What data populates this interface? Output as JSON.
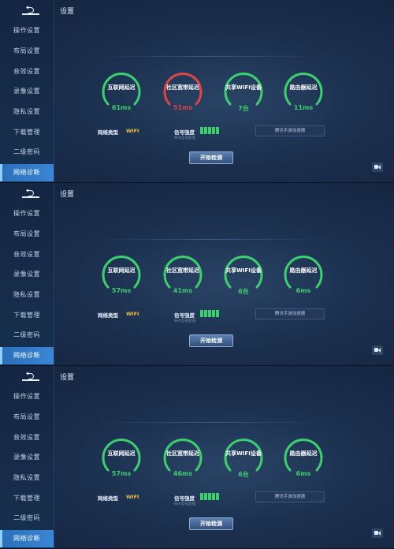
{
  "screens": [
    {
      "title": "设置",
      "nav": [
        "操作设置",
        "布局设置",
        "音效设置",
        "录像设置",
        "隐私设置",
        "下载管理",
        "二级密码",
        "网络诊断"
      ],
      "active_index": 7,
      "gauges": [
        {
          "label": "互联网延迟",
          "value": "61ms",
          "status": "good"
        },
        {
          "label": "社区宽带延迟",
          "value": "51ms",
          "status": "bad"
        },
        {
          "label": "共享WIFI设备",
          "value": "7台",
          "status": "good"
        },
        {
          "label": "路由器延迟",
          "value": "11ms",
          "status": "good"
        }
      ],
      "network_type_label": "网络类型",
      "network_type_value": "WIFI",
      "signal_label": "信号强度",
      "signal_sub": "WiFi信号较强",
      "signal_bars": 5,
      "accel_button": "腾讯手游加速器",
      "start_button": "开始检测"
    },
    {
      "title": "设置",
      "nav": [
        "操作设置",
        "布局设置",
        "音效设置",
        "录像设置",
        "隐私设置",
        "下载管理",
        "二级密码",
        "网络诊断"
      ],
      "active_index": 7,
      "gauges": [
        {
          "label": "互联网延迟",
          "value": "57ms",
          "status": "good"
        },
        {
          "label": "社区宽带延迟",
          "value": "41ms",
          "status": "good"
        },
        {
          "label": "共享WIFI设备",
          "value": "6台",
          "status": "good"
        },
        {
          "label": "路由器延迟",
          "value": "6ms",
          "status": "good"
        }
      ],
      "network_type_label": "网络类型",
      "network_type_value": "WIFI",
      "signal_label": "信号强度",
      "signal_sub": "WiFi信号较强",
      "signal_bars": 5,
      "accel_button": "腾讯手游加速器",
      "start_button": "开始检测"
    },
    {
      "title": "设置",
      "nav": [
        "操作设置",
        "布局设置",
        "音效设置",
        "录像设置",
        "隐私设置",
        "下载管理",
        "二级密码",
        "网络诊断"
      ],
      "active_index": 7,
      "gauges": [
        {
          "label": "互联网延迟",
          "value": "57ms",
          "status": "good"
        },
        {
          "label": "社区宽带延迟",
          "value": "46ms",
          "status": "good"
        },
        {
          "label": "共享WIFI设备",
          "value": "6台",
          "status": "good"
        },
        {
          "label": "路由器延迟",
          "value": "6ms",
          "status": "good"
        }
      ],
      "network_type_label": "网络类型",
      "network_type_value": "WIFI",
      "signal_label": "信号强度",
      "signal_sub": "WiFi信号较强",
      "signal_bars": 5,
      "accel_button": "腾讯手游加速器",
      "start_button": "开始检测"
    }
  ],
  "colors": {
    "good": "#3ccf6e",
    "bad": "#e04545",
    "accent": "#3a86d6",
    "wifi": "#f0c040"
  },
  "icons": {
    "back": "back-arrow-icon",
    "camera": "video-camera-icon"
  }
}
